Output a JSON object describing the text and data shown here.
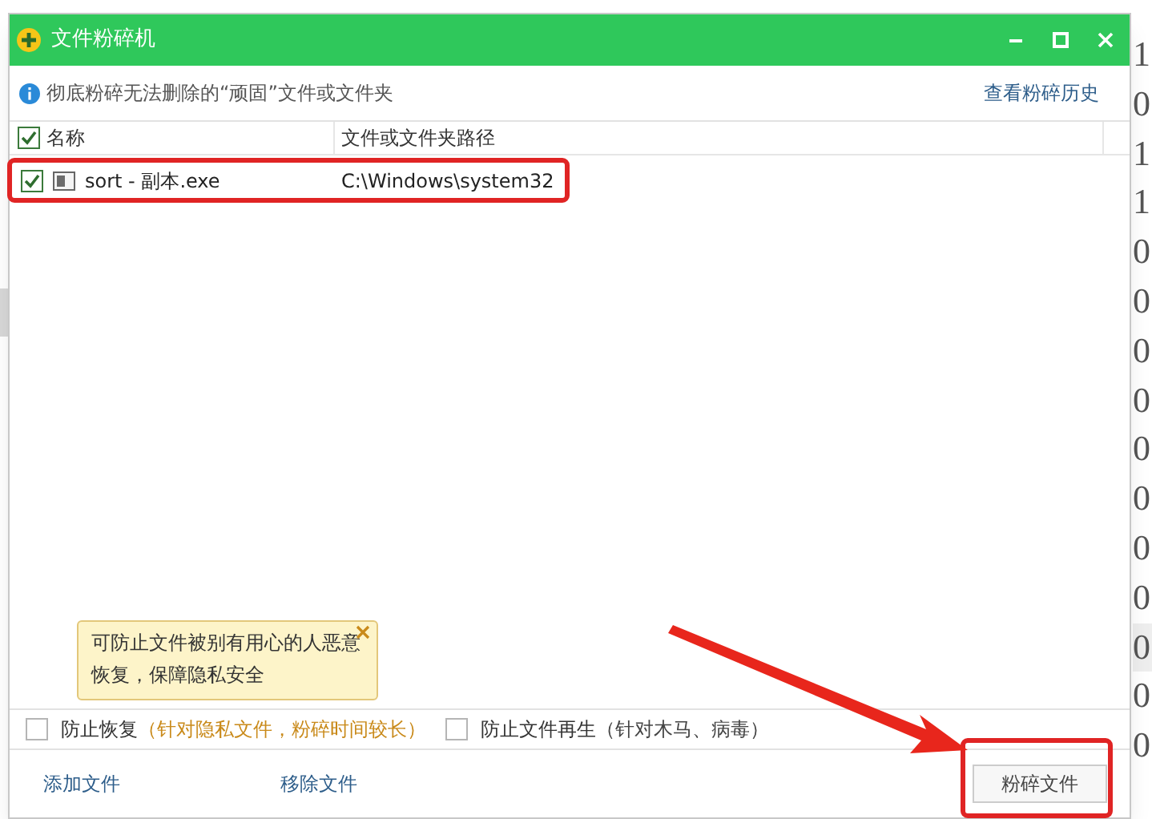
{
  "background_window": {
    "date_column": [
      "1",
      "0",
      "1",
      "1",
      "0",
      "0",
      "0",
      "0",
      "0",
      "0",
      "0",
      "0",
      "0",
      "0",
      "0"
    ]
  },
  "window": {
    "title": "文件粉碎机"
  },
  "info_bar": {
    "text": "彻底粉碎无法删除的“顽固”文件或文件夹",
    "history_link": "查看粉碎历史"
  },
  "table": {
    "header_checked": true,
    "columns": [
      "名称",
      "文件或文件夹路径"
    ],
    "rows": [
      {
        "name": "sort - 副本.exe",
        "path": "C:\\Windows\\system32",
        "checked": true
      }
    ]
  },
  "tooltip": {
    "text": "可防止文件被别有用心的人恶意恢复，保障隐私安全"
  },
  "options": [
    {
      "label": "防止恢复",
      "note": "（针对隐私文件，粉碎时间较长）",
      "kind": "warning",
      "checked": false
    },
    {
      "label": "防止文件再生",
      "note": "（针对木马、病毒）",
      "kind": "plain",
      "checked": false
    }
  ],
  "actions": [
    "添加文件",
    "移除文件"
  ],
  "shred_button": "粉碎文件"
}
